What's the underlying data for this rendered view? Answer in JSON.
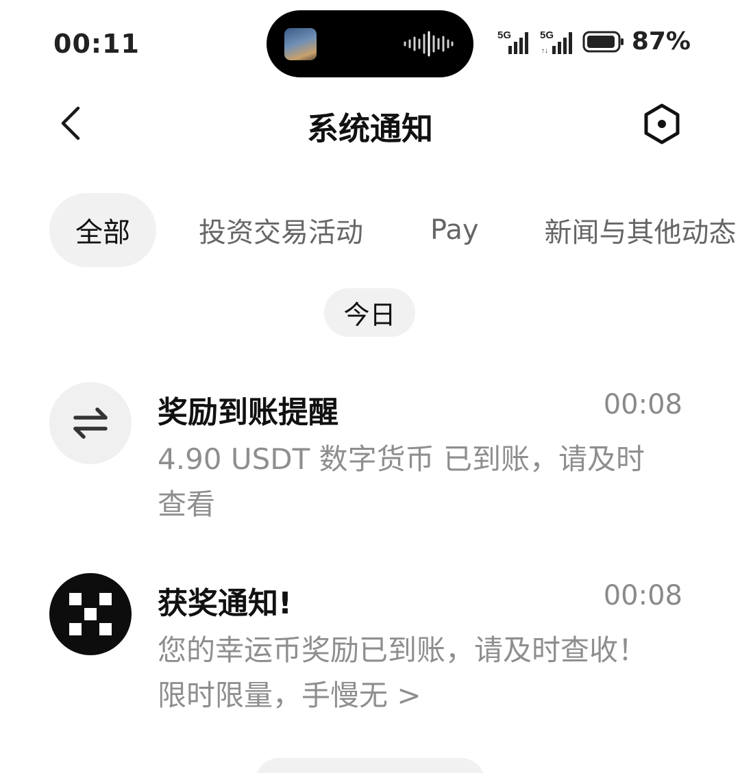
{
  "status_bar": {
    "time": "00:11",
    "battery_percent": "87%",
    "signal_1_label": "5G",
    "signal_2_label": "5G"
  },
  "header": {
    "title": "系统通知",
    "back_icon": "chevron-left-icon",
    "settings_icon": "hexagon-settings-icon"
  },
  "tabs": [
    {
      "label": "全部",
      "active": true
    },
    {
      "label": "投资交易活动",
      "active": false
    },
    {
      "label": "Pay",
      "active": false
    },
    {
      "label": "新闻与其他动态",
      "active": false
    }
  ],
  "date_group": "今日",
  "notifications": [
    {
      "icon": "swap-arrows-icon",
      "title": "奖励到账提醒",
      "time": "00:08",
      "body": "4.90 USDT 数字货币 已到账，请及时查看"
    },
    {
      "icon": "okx-logo-icon",
      "title": "获奖通知!",
      "time": "00:08",
      "body": "您的幸运币奖励已到账，请及时查收！限时限量，手慢无 >"
    }
  ],
  "colors": {
    "accent_bg": "#f1f1f1",
    "text_primary": "#111111",
    "text_secondary": "#8e8e8e"
  }
}
